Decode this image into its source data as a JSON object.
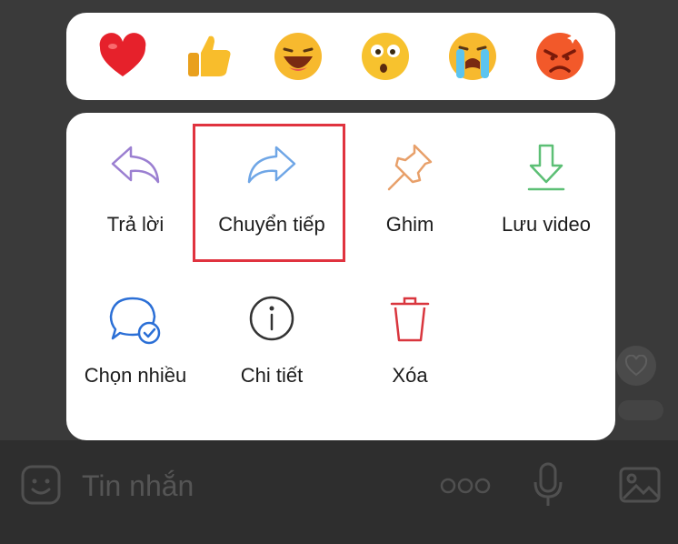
{
  "reactions": [
    {
      "name": "heart",
      "icon": "heart-icon"
    },
    {
      "name": "like",
      "icon": "thumbs-up-icon"
    },
    {
      "name": "haha",
      "icon": "laughing-face-icon"
    },
    {
      "name": "wow",
      "icon": "surprised-face-icon"
    },
    {
      "name": "sad",
      "icon": "crying-face-icon"
    },
    {
      "name": "angry",
      "icon": "angry-face-icon"
    }
  ],
  "actions": {
    "reply": {
      "label": "Trả lời",
      "icon": "reply-arrow-icon",
      "color": "#9b7fd1"
    },
    "forward": {
      "label": "Chuyển tiếp",
      "icon": "forward-arrow-icon",
      "color": "#6fa6e6"
    },
    "pin": {
      "label": "Ghim",
      "icon": "pin-icon",
      "color": "#e8a06a"
    },
    "save_video": {
      "label": "Lưu video",
      "icon": "download-icon",
      "color": "#5cbf75"
    },
    "multi_select": {
      "label": "Chọn nhiều",
      "icon": "chat-check-icon",
      "color": "#2b6fd6"
    },
    "details": {
      "label": "Chi tiết",
      "icon": "info-icon",
      "color": "#333333"
    },
    "delete": {
      "label": "Xóa",
      "icon": "trash-icon",
      "color": "#d9363e"
    }
  },
  "input_bar": {
    "placeholder": "Tin nhắn"
  },
  "highlight_color": "#e0333f"
}
